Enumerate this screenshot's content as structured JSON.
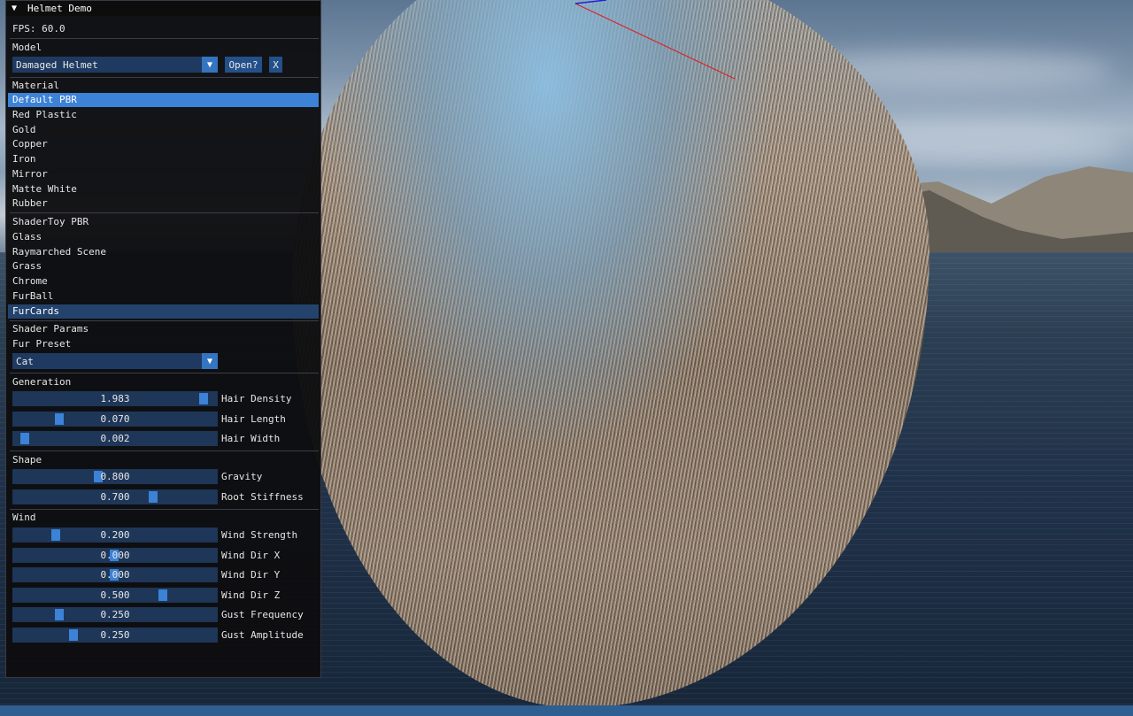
{
  "window": {
    "title": "Helmet Demo",
    "collapse_icon": "triangle-down-icon"
  },
  "fps": "FPS: 60.0",
  "model": {
    "label": "Model",
    "selected": "Damaged Helmet",
    "open_label": "Open?",
    "close_label": "X"
  },
  "material": {
    "label": "Material",
    "items": [
      "Default PBR",
      "Red Plastic",
      "Gold",
      "Copper",
      "Iron",
      "Mirror",
      "Matte White",
      "Rubber"
    ],
    "selected": "Default PBR"
  },
  "shaders": {
    "items": [
      "ShaderToy PBR",
      "Glass",
      "Raymarched Scene",
      "Grass",
      "Chrome",
      "FurBall",
      "FurCards"
    ],
    "selected": "FurCards"
  },
  "shader_params": {
    "label": "Shader Params",
    "fur_preset_label": "Fur Preset",
    "fur_preset": "Cat"
  },
  "generation": {
    "label": "Generation",
    "sliders": [
      {
        "name": "Hair Density",
        "value": "1.983",
        "fraction": 0.96
      },
      {
        "name": "Hair Length",
        "value": "0.070",
        "fraction": 0.22
      },
      {
        "name": "Hair Width",
        "value": "0.002",
        "fraction": 0.04
      }
    ]
  },
  "shape": {
    "label": "Shape",
    "sliders": [
      {
        "name": "Gravity",
        "value": "0.800",
        "fraction": 0.42
      },
      {
        "name": "Root Stiffness",
        "value": "0.700",
        "fraction": 0.7
      }
    ]
  },
  "wind": {
    "label": "Wind",
    "sliders": [
      {
        "name": "Wind Strength",
        "value": "0.200",
        "fraction": 0.2
      },
      {
        "name": "Wind Dir X",
        "value": "0.000",
        "fraction": 0.5
      },
      {
        "name": "Wind Dir Y",
        "value": "0.000",
        "fraction": 0.5
      },
      {
        "name": "Wind Dir Z",
        "value": "0.500",
        "fraction": 0.75
      },
      {
        "name": "Gust Frequency",
        "value": "0.250",
        "fraction": 0.22
      },
      {
        "name": "Gust Amplitude",
        "value": "0.250",
        "fraction": 0.29
      }
    ]
  },
  "colors": {
    "accent": "#3c82d6",
    "frame": "#1e3658",
    "panel": "#0e0e10"
  }
}
